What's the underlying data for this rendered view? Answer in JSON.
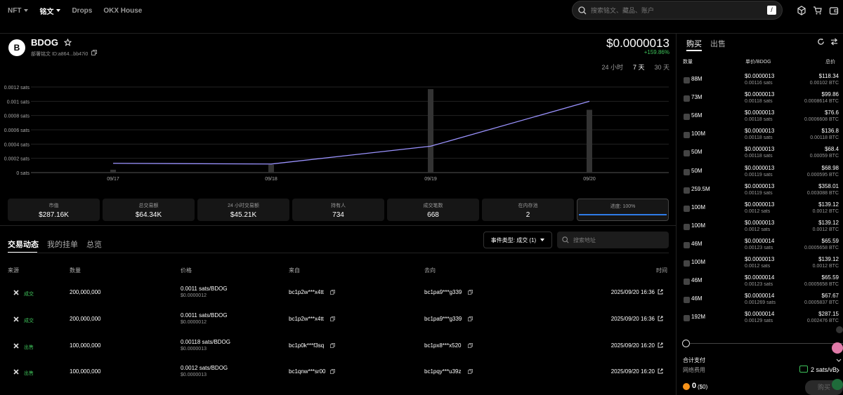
{
  "nav": {
    "items": [
      "NFT",
      "铭文",
      "Drops",
      "OKX House"
    ]
  },
  "search": {
    "placeholder": "搜索铭文、藏品、账户",
    "shortcut": "/"
  },
  "token": {
    "initial": "B",
    "name": "BDOG",
    "deploy_id": "部署铭文 ID:a864...bb47i0",
    "price": "$0.0000013",
    "change": "+159.86%"
  },
  "ranges": [
    "24 小时",
    "7 天",
    "30 天"
  ],
  "chart_data": {
    "type": "line",
    "x": [
      "09/17",
      "09/18",
      "09/19",
      "09/20"
    ],
    "yticks": [
      "0.0012 sats",
      "0.001 sats",
      "0.0008 sats",
      "0.0006 sats",
      "0.0004 sats",
      "0.0002 sats",
      "0 sats"
    ],
    "ylim": [
      0,
      0.0012
    ],
    "series": [
      {
        "kind": "line",
        "values": [
          0.00013,
          0.00012,
          0.00037,
          0.001
        ]
      },
      {
        "kind": "bar",
        "values": [
          4e-05,
          0.00011,
          0.00117,
          0.00088
        ]
      }
    ]
  },
  "stats": [
    {
      "label": "市值",
      "value": "$287.16K"
    },
    {
      "label": "总交易额",
      "value": "$64.34K"
    },
    {
      "label": "24 小时交易额",
      "value": "$45.21K"
    },
    {
      "label": "持有人",
      "value": "734"
    },
    {
      "label": "成交笔数",
      "value": "668"
    },
    {
      "label": "在内存池",
      "value": "2"
    },
    {
      "label": "进度: 100%",
      "value": ""
    }
  ],
  "activity": {
    "tabs": [
      "交易动态",
      "我的挂单",
      "总览"
    ],
    "filter": "事件类型: 成交 (1)",
    "search_placeholder": "搜索地址",
    "headers": [
      "来源",
      "数量",
      "价格",
      "来自",
      "去向",
      "时间"
    ],
    "rows": [
      {
        "type": "成交",
        "qty": "200,000,000",
        "price": "0.0011 sats/BDOG",
        "usd": "$0.0000012",
        "from": "bc1p2w***x4tt",
        "to": "bc1pa9***g339",
        "time": "2025/09/20 16:36"
      },
      {
        "type": "成交",
        "qty": "200,000,000",
        "price": "0.0011 sats/BDOG",
        "usd": "$0.0000012",
        "from": "bc1p2w***x4tt",
        "to": "bc1pa9***g339",
        "time": "2025/09/20 16:36"
      },
      {
        "type": "出售",
        "qty": "100,000,000",
        "price": "0.00118 sats/BDOG",
        "usd": "$0.0000013",
        "from": "bc1p0k***f3sq",
        "to": "bc1px8***x520",
        "time": "2025/09/20 16:20"
      },
      {
        "type": "出售",
        "qty": "100,000,000",
        "price": "0.0012 sats/BDOG",
        "usd": "$0.0000013",
        "from": "bc1qnw***sr00",
        "to": "bc1pqy***u39z",
        "time": "2025/09/20 16:20"
      }
    ]
  },
  "orders": {
    "tabs": [
      "购买",
      "出售"
    ],
    "headers": [
      "数量",
      "单价/BDOG",
      "总价"
    ],
    "rows": [
      {
        "qty": "88M",
        "price": "$0.0000013",
        "sats": "0.00116 sats",
        "usd": "$118.34",
        "btc": "0.00102 BTC"
      },
      {
        "qty": "73M",
        "price": "$0.0000013",
        "sats": "0.00118 sats",
        "usd": "$99.86",
        "btc": "0.0008614 BTC"
      },
      {
        "qty": "56M",
        "price": "$0.0000013",
        "sats": "0.00118 sats",
        "usd": "$76.6",
        "btc": "0.0006608 BTC"
      },
      {
        "qty": "100M",
        "price": "$0.0000013",
        "sats": "0.00118 sats",
        "usd": "$136.8",
        "btc": "0.00118 BTC"
      },
      {
        "qty": "50M",
        "price": "$0.0000013",
        "sats": "0.00118 sats",
        "usd": "$68.4",
        "btc": "0.00059 BTC"
      },
      {
        "qty": "50M",
        "price": "$0.0000013",
        "sats": "0.00119 sats",
        "usd": "$68.98",
        "btc": "0.000595 BTC"
      },
      {
        "qty": "259.5M",
        "price": "$0.0000013",
        "sats": "0.00119 sats",
        "usd": "$358.01",
        "btc": "0.003088 BTC"
      },
      {
        "qty": "100M",
        "price": "$0.0000013",
        "sats": "0.0012 sats",
        "usd": "$139.12",
        "btc": "0.0012 BTC"
      },
      {
        "qty": "100M",
        "price": "$0.0000013",
        "sats": "0.0012 sats",
        "usd": "$139.12",
        "btc": "0.0012 BTC"
      },
      {
        "qty": "46M",
        "price": "$0.0000014",
        "sats": "0.00123 sats",
        "usd": "$65.59",
        "btc": "0.0005658 BTC"
      },
      {
        "qty": "100M",
        "price": "$0.0000013",
        "sats": "0.0012 sats",
        "usd": "$139.12",
        "btc": "0.0012 BTC"
      },
      {
        "qty": "46M",
        "price": "$0.0000014",
        "sats": "0.00123 sats",
        "usd": "$65.59",
        "btc": "0.0005658 BTC"
      },
      {
        "qty": "46M",
        "price": "$0.0000014",
        "sats": "0.001269 sats",
        "usd": "$67.67",
        "btc": "0.0005837 BTC"
      },
      {
        "qty": "192M",
        "price": "$0.0000014",
        "sats": "0.00129 sats",
        "usd": "$287.15",
        "btc": "0.002476 BTC"
      }
    ]
  },
  "summary": {
    "total_label": "合计支付",
    "fee_label": "网络费用",
    "fee_value": "2 sats/vB",
    "amount": "0",
    "amount_usd": "($0)"
  },
  "colors": {
    "accent_green": "#3ec25a",
    "line": "#9b93ff",
    "progress": "#2f7be8"
  }
}
